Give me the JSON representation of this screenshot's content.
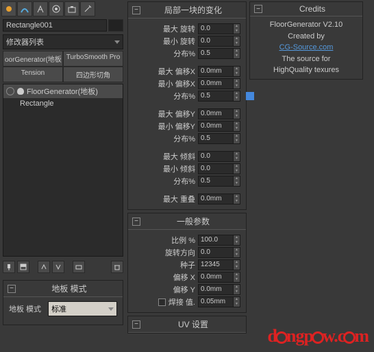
{
  "left": {
    "object_name": "Rectangle001",
    "modifier_list_label": "修改器列表",
    "tabs": [
      "oorGenerator(地板",
      "TurboSmooth Pro"
    ],
    "tabs2": [
      "Tension",
      "四边形切角"
    ],
    "tree": {
      "item1": "FloorGenerator(地板)",
      "item2": "Rectangle"
    },
    "floor_mode_section": "地板 模式",
    "floor_mode_label": "地板 模式",
    "floor_mode_value": "标准"
  },
  "mid": {
    "section1_title": "局部一块的变化",
    "params": {
      "max_rot_label": "最大 旋转",
      "max_rot_val": "0.0",
      "min_rot_label": "最小 旋转",
      "min_rot_val": "0.0",
      "dist1_label": "分布%",
      "dist1_val": "0.5",
      "max_offx_label": "最大 偏移X",
      "max_offx_val": "0.0mm",
      "min_offx_label": "最小 偏移X",
      "min_offx_val": "0.0mm",
      "dist2_label": "分布%",
      "dist2_val": "0.5",
      "max_offy_label": "最大 偏移Y",
      "max_offy_val": "0.0mm",
      "min_offy_label": "最小 偏移Y",
      "min_offy_val": "0.0mm",
      "dist3_label": "分布%",
      "dist3_val": "0.5",
      "max_tilt_label": "最大 倾斜",
      "max_tilt_val": "0.0",
      "min_tilt_label": "最小 倾斜",
      "min_tilt_val": "0.0",
      "dist4_label": "分布%",
      "dist4_val": "0.5",
      "max_overlap_label": "最大 重叠",
      "max_overlap_val": "0.0mm"
    },
    "section2_title": "一般参数",
    "general": {
      "scale_label": "比例 %",
      "scale_val": "100.0",
      "rotdir_label": "旋转方向",
      "rotdir_val": "0.0",
      "seed_label": "种子",
      "seed_val": "12345",
      "offx_label": "偏移 X",
      "offx_val": "0.0mm",
      "offy_label": "偏移 Y",
      "offy_val": "0.0mm",
      "weld_label": "焊接 值.",
      "weld_val": "0.05mm"
    },
    "section3_title": "UV 设置"
  },
  "right": {
    "credits_title": "Credits",
    "line1": "FloorGenerator V2.10",
    "line2": "Created by",
    "link": "CG-Source.com",
    "line3": "The source for",
    "line4": "HighQuality texures"
  },
  "watermark": "dongpow.com"
}
